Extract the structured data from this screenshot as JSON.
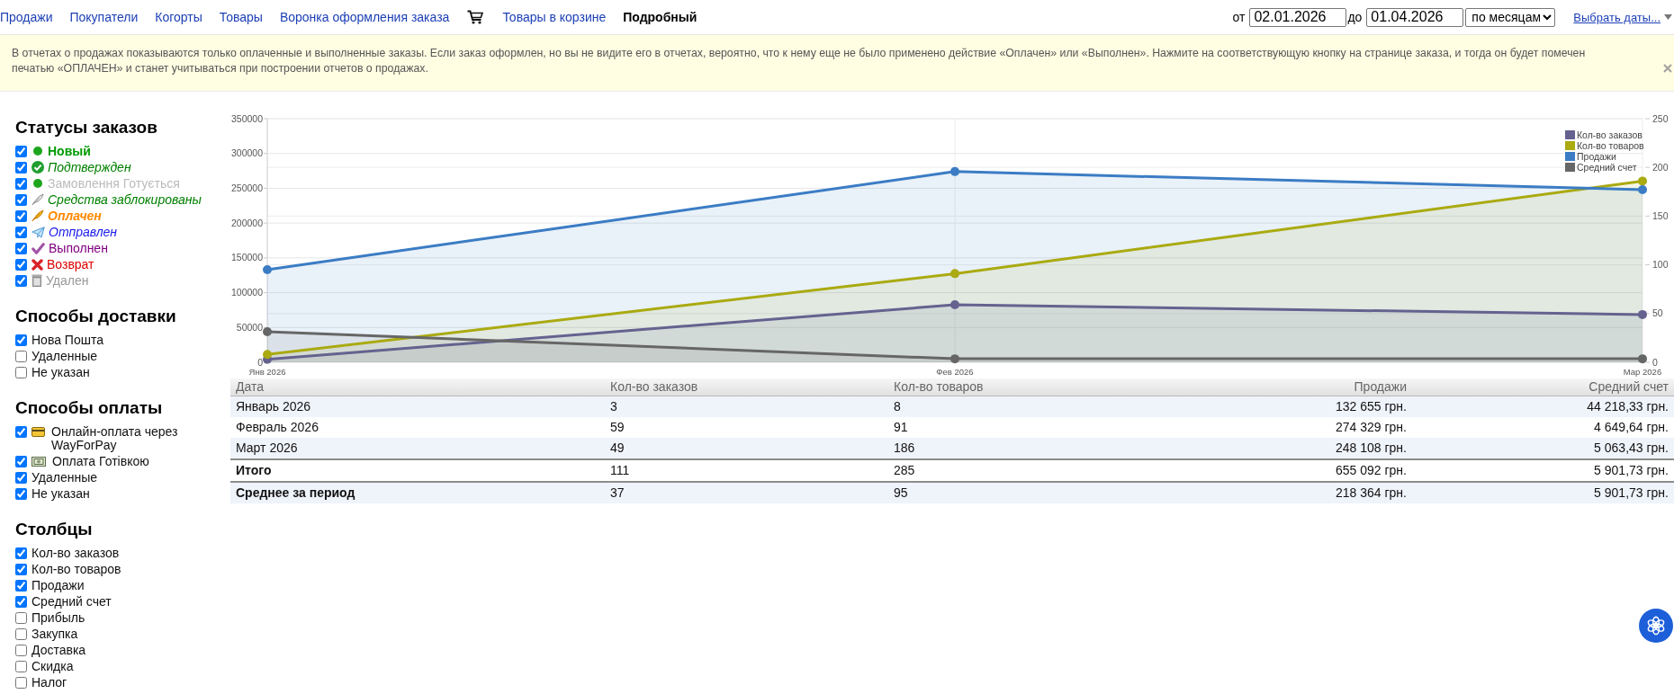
{
  "nav": {
    "items": [
      {
        "kind": "link",
        "label": "Продажи",
        "selected": false
      },
      {
        "kind": "link",
        "label": "Покупатели",
        "selected": false
      },
      {
        "kind": "link",
        "label": "Когорты",
        "selected": false
      },
      {
        "kind": "link",
        "label": "Товары",
        "selected": false
      },
      {
        "kind": "link",
        "label": "Воронка оформления заказа",
        "selected": false
      },
      {
        "kind": "cart",
        "selected": false
      },
      {
        "kind": "link",
        "label": "Товары в корзине",
        "selected": false
      },
      {
        "kind": "link",
        "label": "Подробный",
        "selected": true
      }
    ]
  },
  "date_filter": {
    "from_label": "от",
    "from_value": "02.01.2026",
    "to_label": "до",
    "to_value": "01.04.2026",
    "period": "по месяцам",
    "choose_dates": "Выбрать даты..."
  },
  "notice": {
    "text": "В отчетах о продажах показываются только оплаченные и выполненные заказы. Если заказ оформлен, но вы не видите его в отчетах, вероятно, что к нему еще не было применено действие «Оплачен» или «Выполнен». Нажмите на соответствующую кнопку на странице заказа, и тогда он будет помечен печатью «ОПЛАЧЕН» и станет учитываться при построении отчетов о продажах."
  },
  "sidebar": {
    "sections": [
      {
        "title": "Статусы заказов",
        "items": [
          {
            "kind": "new",
            "label": "Новый",
            "color": "#009a00",
            "checked": true
          },
          {
            "kind": "confirmed",
            "label": "Подтвержден",
            "color": "#008000",
            "checked": true
          },
          {
            "kind": "preparing",
            "label": "Замовлення Готується",
            "color": "#bbbbbb",
            "checked": true
          },
          {
            "kind": "blocked",
            "label": "Средства заблокированы",
            "color": "#008000",
            "checked": true
          },
          {
            "kind": "paid",
            "label": "Оплачен",
            "color": "#ff8800",
            "checked": true
          },
          {
            "kind": "shipped",
            "label": "Отправлен",
            "color": "#1a1aee",
            "checked": true
          },
          {
            "kind": "done",
            "label": "Выполнен",
            "color": "#800080",
            "checked": true
          },
          {
            "kind": "refund",
            "label": "Возврат",
            "color": "#dd0000",
            "checked": true
          },
          {
            "kind": "deleted",
            "label": "Удален",
            "color": "#999999",
            "checked": true
          }
        ]
      },
      {
        "title": "Способы доставки",
        "items": [
          {
            "label": "Нова Пошта",
            "checked": true
          },
          {
            "label": "Удаленные",
            "checked": false
          },
          {
            "label": "Не указан",
            "checked": false
          }
        ]
      },
      {
        "title": "Способы оплаты",
        "items": [
          {
            "kind": "card",
            "label": "Онлайн-оплата через WayForPay",
            "checked": true
          },
          {
            "kind": "cash",
            "label": "Оплата Готівкою",
            "checked": true
          },
          {
            "kind": "plain",
            "label": "Удаленные",
            "checked": true
          },
          {
            "kind": "plain",
            "label": "Не указан",
            "checked": true
          }
        ]
      },
      {
        "title": "Столбцы",
        "items": [
          {
            "label": "Кол-во заказов",
            "checked": true
          },
          {
            "label": "Кол-во товаров",
            "checked": true
          },
          {
            "label": "Продажи",
            "checked": true
          },
          {
            "label": "Средний счет",
            "checked": true
          },
          {
            "label": "Прибыль",
            "checked": false
          },
          {
            "label": "Закупка",
            "checked": false
          },
          {
            "label": "Доставка",
            "checked": false
          },
          {
            "label": "Скидка",
            "checked": false
          },
          {
            "label": "Налог",
            "checked": false
          }
        ]
      }
    ]
  },
  "chart": {
    "chart_data": {
      "type": "area",
      "categories": [
        "Янв 2026",
        "Фев 2026",
        "Мар 2026"
      ],
      "grid": true,
      "legend": "top-right",
      "ylim": [
        0,
        350000
      ],
      "yticks": [
        0,
        50000,
        100000,
        150000,
        200000,
        250000,
        300000,
        350000
      ],
      "y2lim": [
        0,
        250
      ],
      "y2ticks": [
        0,
        50,
        100,
        150,
        200,
        250
      ],
      "series": [
        {
          "name": "Кол-во заказов",
          "color": "#65628f",
          "axis": "y2",
          "values": [
            3,
            59,
            49
          ]
        },
        {
          "name": "Кол-во товаров",
          "color": "#aaaa11",
          "axis": "y2",
          "values": [
            8,
            91,
            186
          ]
        },
        {
          "name": "Продажи",
          "color": "#3b7cc4",
          "values": [
            133000,
            274000,
            248000
          ]
        },
        {
          "name": "Средний счет",
          "color": "#666666",
          "values": [
            44000,
            5000,
            5000
          ]
        }
      ]
    }
  },
  "table": {
    "columns": [
      "Дата",
      "Кол-во заказов",
      "Кол-во товаров",
      "Продажи",
      "Средний счет"
    ],
    "rows": [
      {
        "kind": "data",
        "cells": [
          "Январь 2026",
          "3",
          "8",
          "132 655 грн.",
          "44 218,33 грн."
        ]
      },
      {
        "kind": "data",
        "cells": [
          "Февраль 2026",
          "59",
          "91",
          "274 329 грн.",
          "4 649,64 грн."
        ]
      },
      {
        "kind": "data",
        "cells": [
          "Март 2026",
          "49",
          "186",
          "248 108 грн.",
          "5 063,43 грн."
        ]
      },
      {
        "kind": "summary",
        "cells": [
          "Итого",
          "111",
          "285",
          "655 092 грн.",
          "5 901,73 грн."
        ]
      },
      {
        "kind": "summary",
        "cells": [
          "Среднее за период",
          "37",
          "95",
          "218 364 грн.",
          "5 901,73 грн."
        ]
      }
    ]
  }
}
